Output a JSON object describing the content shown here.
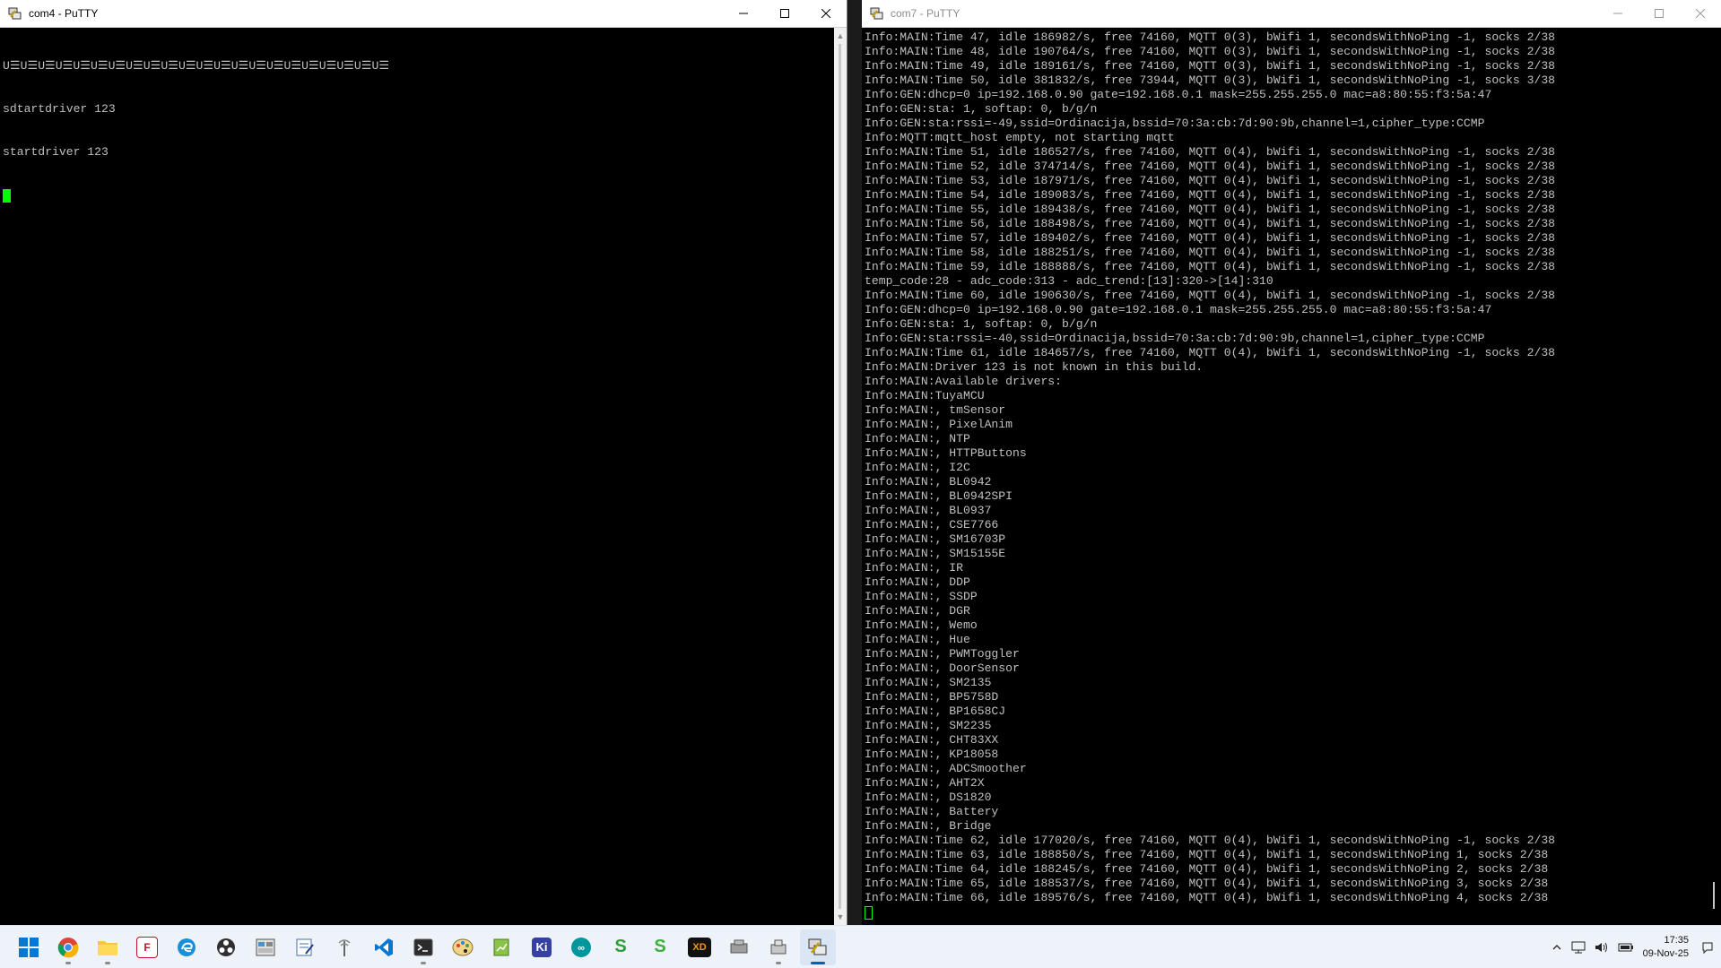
{
  "left_window": {
    "title": "com4 - PuTTY",
    "lines": [
      "U☰U☰U☰U☰U☰U☰U☰U☰U☰U☰U☰U☰U☰U☰U☰U☰U☰U☰U☰U☰U☰U☰",
      "sdtartdriver 123",
      "startdriver 123"
    ]
  },
  "right_window": {
    "title": "com7 - PuTTY",
    "lines": [
      "Info:MAIN:Time 47, idle 186982/s, free 74160, MQTT 0(3), bWifi 1, secondsWithNoPing -1, socks 2/38",
      "Info:MAIN:Time 48, idle 190764/s, free 74160, MQTT 0(3), bWifi 1, secondsWithNoPing -1, socks 2/38",
      "Info:MAIN:Time 49, idle 189161/s, free 74160, MQTT 0(3), bWifi 1, secondsWithNoPing -1, socks 2/38",
      "Info:MAIN:Time 50, idle 381832/s, free 73944, MQTT 0(3), bWifi 1, secondsWithNoPing -1, socks 3/38",
      "Info:GEN:dhcp=0 ip=192.168.0.90 gate=192.168.0.1 mask=255.255.255.0 mac=a8:80:55:f3:5a:47",
      "Info:GEN:sta: 1, softap: 0, b/g/n",
      "Info:GEN:sta:rssi=-49,ssid=Ordinacija,bssid=70:3a:cb:7d:90:9b,channel=1,cipher_type:CCMP",
      "Info:MQTT:mqtt_host empty, not starting mqtt",
      "Info:MAIN:Time 51, idle 186527/s, free 74160, MQTT 0(4), bWifi 1, secondsWithNoPing -1, socks 2/38",
      "Info:MAIN:Time 52, idle 374714/s, free 74160, MQTT 0(4), bWifi 1, secondsWithNoPing -1, socks 2/38",
      "Info:MAIN:Time 53, idle 187971/s, free 74160, MQTT 0(4), bWifi 1, secondsWithNoPing -1, socks 2/38",
      "Info:MAIN:Time 54, idle 189083/s, free 74160, MQTT 0(4), bWifi 1, secondsWithNoPing -1, socks 2/38",
      "Info:MAIN:Time 55, idle 189438/s, free 74160, MQTT 0(4), bWifi 1, secondsWithNoPing -1, socks 2/38",
      "Info:MAIN:Time 56, idle 188498/s, free 74160, MQTT 0(4), bWifi 1, secondsWithNoPing -1, socks 2/38",
      "Info:MAIN:Time 57, idle 189402/s, free 74160, MQTT 0(4), bWifi 1, secondsWithNoPing -1, socks 2/38",
      "Info:MAIN:Time 58, idle 188251/s, free 74160, MQTT 0(4), bWifi 1, secondsWithNoPing -1, socks 2/38",
      "Info:MAIN:Time 59, idle 188888/s, free 74160, MQTT 0(4), bWifi 1, secondsWithNoPing -1, socks 2/38",
      "temp_code:28 - adc_code:313 - adc_trend:[13]:320->[14]:310",
      "Info:MAIN:Time 60, idle 190630/s, free 74160, MQTT 0(4), bWifi 1, secondsWithNoPing -1, socks 2/38",
      "Info:GEN:dhcp=0 ip=192.168.0.90 gate=192.168.0.1 mask=255.255.255.0 mac=a8:80:55:f3:5a:47",
      "Info:GEN:sta: 1, softap: 0, b/g/n",
      "Info:GEN:sta:rssi=-40,ssid=Ordinacija,bssid=70:3a:cb:7d:90:9b,channel=1,cipher_type:CCMP",
      "Info:MAIN:Time 61, idle 184657/s, free 74160, MQTT 0(4), bWifi 1, secondsWithNoPing -1, socks 2/38",
      "Info:MAIN:Driver 123 is not known in this build.",
      "Info:MAIN:Available drivers:",
      "Info:MAIN:TuyaMCU",
      "Info:MAIN:, tmSensor",
      "Info:MAIN:, PixelAnim",
      "Info:MAIN:, NTP",
      "Info:MAIN:, HTTPButtons",
      "Info:MAIN:, I2C",
      "Info:MAIN:, BL0942",
      "Info:MAIN:, BL0942SPI",
      "Info:MAIN:, BL0937",
      "Info:MAIN:, CSE7766",
      "Info:MAIN:, SM16703P",
      "Info:MAIN:, SM15155E",
      "Info:MAIN:, IR",
      "Info:MAIN:, DDP",
      "Info:MAIN:, SSDP",
      "Info:MAIN:, DGR",
      "Info:MAIN:, Wemo",
      "Info:MAIN:, Hue",
      "Info:MAIN:, PWMToggler",
      "Info:MAIN:, DoorSensor",
      "Info:MAIN:, SM2135",
      "Info:MAIN:, BP5758D",
      "Info:MAIN:, BP1658CJ",
      "Info:MAIN:, SM2235",
      "Info:MAIN:, CHT83XX",
      "Info:MAIN:, KP18058",
      "Info:MAIN:, ADCSmoother",
      "Info:MAIN:, AHT2X",
      "Info:MAIN:, DS1820",
      "Info:MAIN:, Battery",
      "Info:MAIN:, Bridge",
      "Info:MAIN:Time 62, idle 177020/s, free 74160, MQTT 0(4), bWifi 1, secondsWithNoPing -1, socks 2/38",
      "Info:MAIN:Time 63, idle 188850/s, free 74160, MQTT 0(4), bWifi 1, secondsWithNoPing 1, socks 2/38",
      "Info:MAIN:Time 64, idle 188245/s, free 74160, MQTT 0(4), bWifi 1, secondsWithNoPing 2, socks 2/38",
      "Info:MAIN:Time 65, idle 188537/s, free 74160, MQTT 0(4), bWifi 1, secondsWithNoPing 3, socks 2/38",
      "Info:MAIN:Time 66, idle 189576/s, free 74160, MQTT 0(4), bWifi 1, secondsWithNoPing 4, socks 2/38"
    ]
  },
  "taskbar": {
    "clock_time": "17:35",
    "clock_date": "09-Nov-25",
    "apps": [
      "start-icon",
      "chrome-icon",
      "file-explorer-icon",
      "foxit-pdf-icon",
      "edge-icon",
      "obs-icon",
      "control-panel-icon",
      "certificate-editor-icon",
      "antenna-tool-icon",
      "vscode-icon",
      "terminal-icon",
      "paint-tool-icon",
      "notepad-icon",
      "kicad-icon",
      "arduino-icon",
      "sourcetree-icon",
      "s-app-icon",
      "xd-app-icon",
      "flasher-icon",
      "usb-tool-icon",
      "putty-icon"
    ]
  },
  "colors": {
    "terminal_bg": "#000000",
    "terminal_fg": "#c0c0c0",
    "cursor": "#00ff00",
    "taskbar_bg": "#eef3f9"
  }
}
